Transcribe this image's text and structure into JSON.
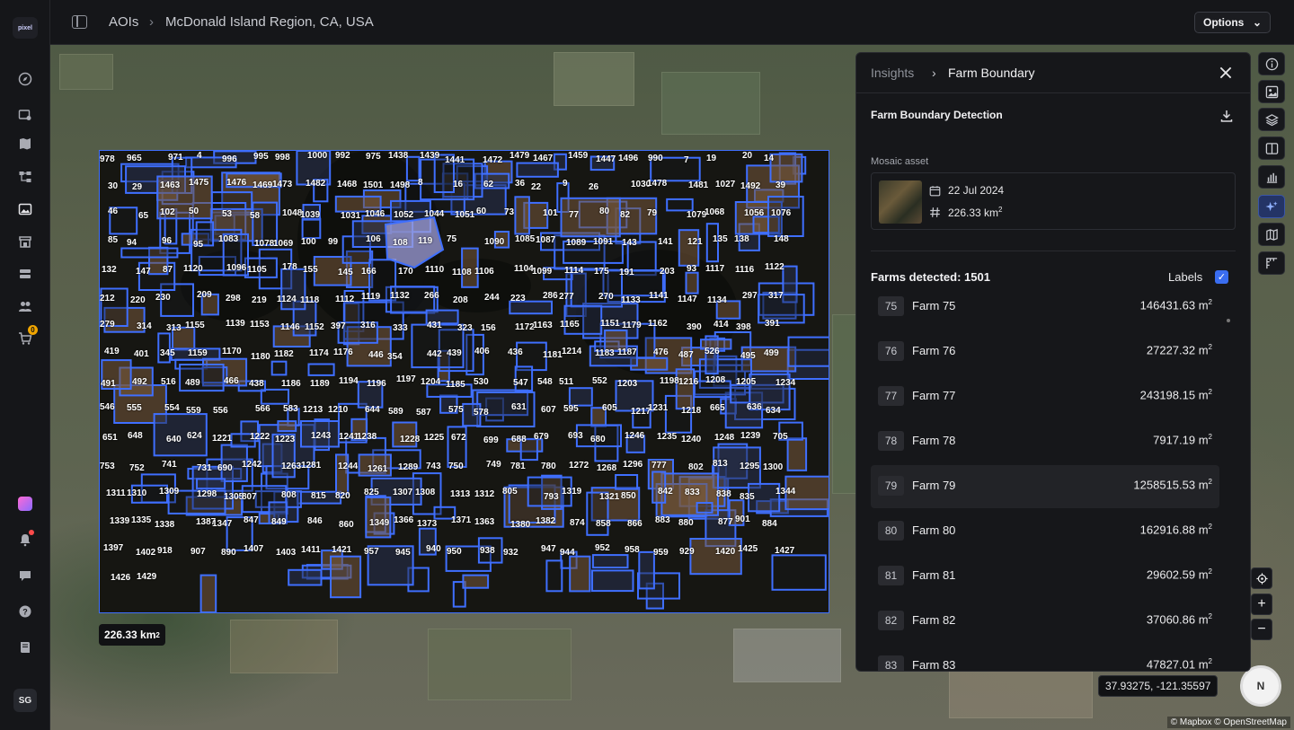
{
  "app": {
    "logo_text": "pixel",
    "cart_count": "0",
    "user_initials": "SG"
  },
  "breadcrumb": {
    "root": "AOIs",
    "current": "McDonald Island Region, CA, USA"
  },
  "toolbar": {
    "options_label": "Options"
  },
  "map": {
    "aoi_area": "226.33 km",
    "aoi_area_unit_sup": "2",
    "coords": "37.93275, -121.35597",
    "attribution": "© Mapbox © OpenStreetMap",
    "compass_label": "N",
    "zoom_in": "+",
    "zoom_out": "−",
    "farm_labels": [
      "978",
      "965",
      "971",
      "4",
      "996",
      "995",
      "998",
      "1000",
      "992",
      "975",
      "1438",
      "1439",
      "1441",
      "1472",
      "1479",
      "1467",
      "1459",
      "1447",
      "1496",
      "990",
      "7",
      "19",
      "20",
      "14",
      "30",
      "29",
      "1463",
      "1475",
      "1476",
      "1469",
      "1473",
      "1482",
      "1468",
      "1501",
      "1498",
      "8",
      "16",
      "62",
      "36",
      "22",
      "9",
      "26",
      "1030",
      "1478",
      "1481",
      "1027",
      "1492",
      "39",
      "46",
      "65",
      "102",
      "50",
      "53",
      "58",
      "1048",
      "1039",
      "1031",
      "1046",
      "1052",
      "1044",
      "1051",
      "60",
      "73",
      "101",
      "77",
      "80",
      "82",
      "79",
      "1079",
      "1068",
      "1056",
      "1076",
      "85",
      "94",
      "96",
      "95",
      "1083",
      "1078",
      "1069",
      "100",
      "99",
      "106",
      "108",
      "119",
      "75",
      "1090",
      "1085",
      "1087",
      "1089",
      "1091",
      "143",
      "141",
      "121",
      "135",
      "138",
      "148",
      "132",
      "147",
      "87",
      "1120",
      "1096",
      "1105",
      "178",
      "155",
      "145",
      "166",
      "170",
      "1110",
      "1108",
      "1106",
      "1104",
      "1099",
      "1114",
      "175",
      "191",
      "203",
      "93",
      "1117",
      "1116",
      "1122",
      "212",
      "220",
      "230",
      "209",
      "298",
      "219",
      "1124",
      "1118",
      "1112",
      "1119",
      "1132",
      "266",
      "208",
      "244",
      "223",
      "286",
      "277",
      "270",
      "1133",
      "1141",
      "1147",
      "1134",
      "297",
      "317",
      "279",
      "314",
      "313",
      "1155",
      "1139",
      "1153",
      "1146",
      "1152",
      "397",
      "316",
      "333",
      "431",
      "323",
      "156",
      "1172",
      "1163",
      "1165",
      "1151",
      "1179",
      "1162",
      "390",
      "414",
      "398",
      "391",
      "419",
      "401",
      "345",
      "1159",
      "1170",
      "1180",
      "1182",
      "1174",
      "1176",
      "446",
      "354",
      "442",
      "439",
      "406",
      "436",
      "1181",
      "1214",
      "1183",
      "1187",
      "476",
      "487",
      "526",
      "495",
      "499",
      "491",
      "492",
      "516",
      "489",
      "466",
      "438",
      "1186",
      "1189",
      "1194",
      "1196",
      "1197",
      "1204",
      "1185",
      "530",
      "547",
      "548",
      "511",
      "552",
      "1203",
      "1198",
      "1216",
      "1208",
      "1205",
      "1234",
      "546",
      "555",
      "554",
      "559",
      "556",
      "566",
      "583",
      "1213",
      "1210",
      "644",
      "589",
      "587",
      "575",
      "578",
      "631",
      "607",
      "595",
      "605",
      "1217",
      "1231",
      "1218",
      "665",
      "636",
      "634",
      "651",
      "648",
      "640",
      "624",
      "1221",
      "1222",
      "1223",
      "1243",
      "1241",
      "1238",
      "1228",
      "1225",
      "672",
      "699",
      "688",
      "679",
      "693",
      "680",
      "1246",
      "1235",
      "1240",
      "1248",
      "1239",
      "705",
      "753",
      "752",
      "741",
      "731",
      "690",
      "1242",
      "1263",
      "1281",
      "1244",
      "1261",
      "1289",
      "743",
      "750",
      "749",
      "781",
      "780",
      "1272",
      "1268",
      "1296",
      "777",
      "802",
      "813",
      "1295",
      "1300",
      "1311",
      "1310",
      "1309",
      "1298",
      "1305",
      "807",
      "808",
      "815",
      "820",
      "825",
      "1307",
      "1308",
      "1313",
      "1312",
      "805",
      "793",
      "1319",
      "1321",
      "850",
      "842",
      "833",
      "838",
      "835",
      "1344",
      "1339",
      "1335",
      "1338",
      "1387",
      "1347",
      "847",
      "849",
      "846",
      "860",
      "1349",
      "1366",
      "1373",
      "1371",
      "1363",
      "1380",
      "1382",
      "874",
      "858",
      "866",
      "883",
      "880",
      "877",
      "901",
      "884",
      "1397",
      "1402",
      "918",
      "907",
      "890",
      "1407",
      "1403",
      "1411",
      "1421",
      "957",
      "945",
      "940",
      "950",
      "938",
      "932",
      "947",
      "944",
      "952",
      "958",
      "959",
      "929",
      "1420",
      "1425",
      "1427",
      "1426",
      "1429"
    ]
  },
  "tools": [
    "info-icon",
    "image-icon",
    "layers-icon",
    "split-view-icon",
    "chart-icon",
    "sparkle-icon",
    "map-icon",
    "measure-icon"
  ],
  "panel": {
    "breadcrumb_root": "Insights",
    "breadcrumb_current": "Farm Boundary",
    "section_title": "Farm Boundary Detection",
    "mosaic_label": "Mosaic asset",
    "mosaic_date": "22 Jul 2024",
    "mosaic_area": "226.33 km",
    "mosaic_area_sup": "2",
    "farms_detected": "Farms detected: 1501",
    "labels_toggle_label": "Labels",
    "labels_checked": true,
    "farms": [
      {
        "id": "75",
        "name": "Farm 75",
        "area": "146431.63 m",
        "sup": "2"
      },
      {
        "id": "76",
        "name": "Farm 76",
        "area": "27227.32 m",
        "sup": "2"
      },
      {
        "id": "77",
        "name": "Farm 77",
        "area": "243198.15 m",
        "sup": "2"
      },
      {
        "id": "78",
        "name": "Farm 78",
        "area": "7917.19 m",
        "sup": "2"
      },
      {
        "id": "79",
        "name": "Farm 79",
        "area": "1258515.53 m",
        "sup": "2",
        "highlighted": true
      },
      {
        "id": "80",
        "name": "Farm 80",
        "area": "162916.88 m",
        "sup": "2"
      },
      {
        "id": "81",
        "name": "Farm 81",
        "area": "29602.59 m",
        "sup": "2"
      },
      {
        "id": "82",
        "name": "Farm 82",
        "area": "37060.86 m",
        "sup": "2"
      },
      {
        "id": "83",
        "name": "Farm 83",
        "area": "47827.01 m",
        "sup": "2"
      }
    ]
  },
  "colors": {
    "accent": "#3f6fff",
    "panel_bg": "#16171a",
    "rail_bg": "#151619"
  }
}
